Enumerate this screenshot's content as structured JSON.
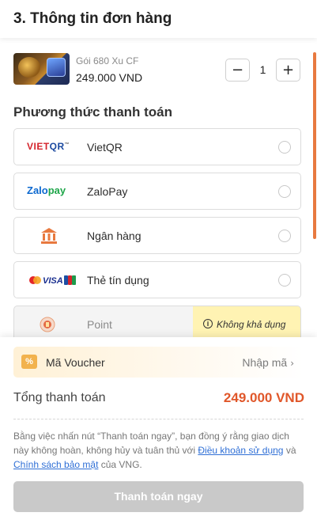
{
  "header": {
    "title": "3. Thông tin đơn hàng"
  },
  "product": {
    "name": "Gói 680 Xu CF",
    "price": "249.000 VND",
    "quantity": "1",
    "minus_symbol": "−",
    "plus_symbol": "+"
  },
  "payment": {
    "section_title": "Phương thức thanh toán",
    "methods": [
      {
        "label": "VietQR",
        "icon": "vietqr-logo",
        "logo_text_a": "VIET",
        "logo_text_b": "QR",
        "logo_mark": "™",
        "selected": false
      },
      {
        "label": "ZaloPay",
        "icon": "zalopay-logo",
        "logo_text_a": "Zalo",
        "logo_text_b": "pay",
        "selected": false
      },
      {
        "label": "Ngân hàng",
        "icon": "bank-icon",
        "selected": false
      },
      {
        "label": "Thẻ tín dụng",
        "icon": "credit-card-logos",
        "logo_text_a": "VISA",
        "selected": false
      },
      {
        "label": "Point",
        "icon": "point-icon",
        "disabled": true,
        "status": "Không khả dụng"
      }
    ]
  },
  "voucher": {
    "label": "Mã Voucher",
    "action": "Nhập mã",
    "chevron": "›"
  },
  "total": {
    "label": "Tổng thanh toán",
    "value": "249.000 VND"
  },
  "terms": {
    "text_1": "Bằng việc nhấn nút “Thanh toán ngay”, bạn đồng ý rằng giao dịch này không hoàn, không hủy và tuân thủ với ",
    "link_1": "Điều khoản sử dụng",
    "text_2": " và ",
    "link_2": "Chính sách bảo mật",
    "text_3": " của VNG."
  },
  "actions": {
    "pay_now": "Thanh toán ngay"
  },
  "colors": {
    "accent": "#e0572a",
    "scrollbar": "#e8793f",
    "unavailable_bg": "#fff3b3",
    "disabled_button": "#c9c9c9",
    "link": "#2f6fd6"
  }
}
